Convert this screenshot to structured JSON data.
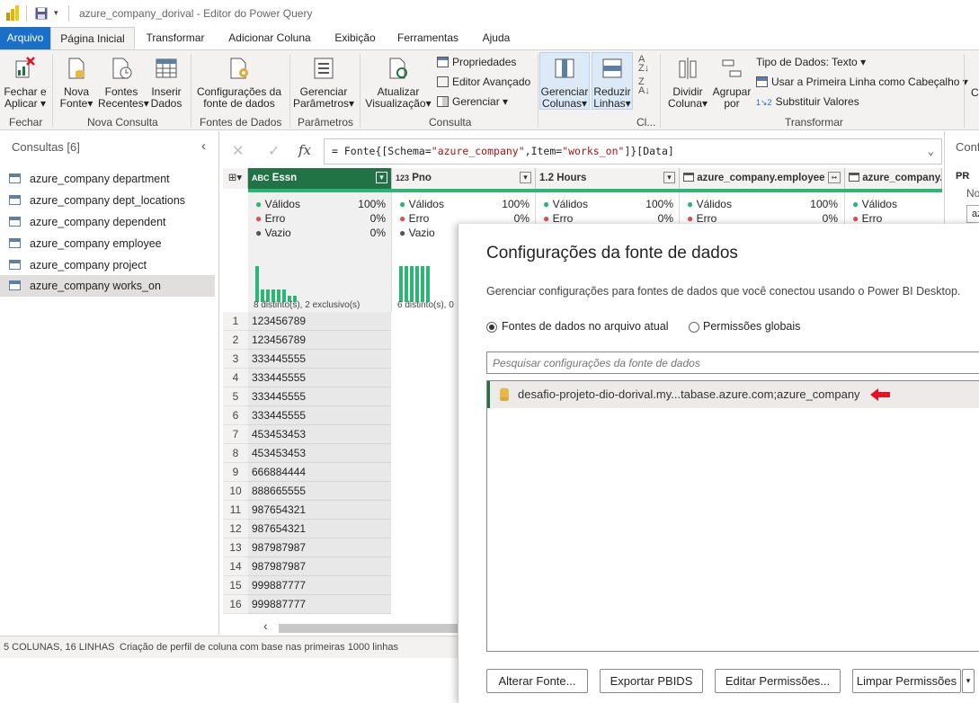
{
  "window": {
    "title": "azure_company_dorival - Editor do Power Query"
  },
  "tabs": [
    {
      "label": "Arquivo"
    },
    {
      "label": "Página Inicial"
    },
    {
      "label": "Transformar"
    },
    {
      "label": "Adicionar Coluna"
    },
    {
      "label": "Exibição"
    },
    {
      "label": "Ferramentas"
    },
    {
      "label": "Ajuda"
    }
  ],
  "ribbon": {
    "fechar_aplicar_1": "Fechar e",
    "fechar_aplicar_2": "Aplicar",
    "nova_fonte_1": "Nova",
    "nova_fonte_2": "Fonte",
    "fontes_recentes_1": "Fontes",
    "fontes_recentes_2": "Recentes",
    "inserir_dados_1": "Inserir",
    "inserir_dados_2": "Dados",
    "config_fonte_1": "Configurações da",
    "config_fonte_2": "fonte de dados",
    "gerenciar_param_1": "Gerenciar",
    "gerenciar_param_2": "Parâmetros",
    "atualizar_1": "Atualizar",
    "atualizar_2": "Visualização",
    "propriedades": "Propriedades",
    "editor_avancado": "Editor Avançado",
    "gerenciar": "Gerenciar",
    "gerenciar_colunas_1": "Gerenciar",
    "gerenciar_colunas_2": "Colunas",
    "reduzir_linhas_1": "Reduzir",
    "reduzir_linhas_2": "Linhas",
    "dividir_coluna_1": "Dividir",
    "dividir_coluna_2": "Coluna",
    "agrupar_por_1": "Agrupar",
    "agrupar_por_2": "por",
    "tipo_dados": "Tipo de Dados: Texto",
    "primeira_linha": "Usar a Primeira Linha como Cabeçalho",
    "substituir": "Substituir Valores",
    "cut_label": "Co",
    "groups": {
      "fechar": "Fechar",
      "nova_consulta": "Nova Consulta",
      "fontes_dados": "Fontes de Dados",
      "parametros": "Parâmetros",
      "consulta": "Consulta",
      "cl": "Cl...",
      "transformar": "Transformar"
    }
  },
  "sidebar": {
    "title": "Consultas [6]",
    "items": [
      {
        "label": "azure_company department"
      },
      {
        "label": "azure_company dept_locations"
      },
      {
        "label": "azure_company dependent"
      },
      {
        "label": "azure_company employee"
      },
      {
        "label": "azure_company project"
      },
      {
        "label": "azure_company works_on"
      }
    ]
  },
  "formula": {
    "prefix": "= Fonte{[Schema=",
    "schema": "\"azure_company\"",
    "mid": ",Item=",
    "item": "\"works_on\"",
    "suffix": "]}[Data]"
  },
  "columns": [
    {
      "type": "ABC",
      "name": "Essn",
      "valid": "100%",
      "error": "0%",
      "empty": "0%",
      "distinct": "8 distinto(s), 2 exclusivo(s)"
    },
    {
      "type": "123",
      "name": "Pno",
      "valid": "100%",
      "error": "0%",
      "empty": "0%",
      "distinct": "6 distinto(s), 0"
    },
    {
      "type": "1.2",
      "name": "Hours",
      "valid": "100%",
      "error": "0%"
    },
    {
      "type": "table",
      "name": "azure_company.employee",
      "valid": "100%",
      "error": "0%"
    },
    {
      "type": "table",
      "name": "azure_company."
    }
  ],
  "profile_labels": {
    "valid": "Válidos",
    "error": "Erro",
    "empty": "Vazio"
  },
  "rows": [
    {
      "n": "1",
      "essn": "123456789"
    },
    {
      "n": "2",
      "essn": "123456789"
    },
    {
      "n": "3",
      "essn": "333445555"
    },
    {
      "n": "4",
      "essn": "333445555"
    },
    {
      "n": "5",
      "essn": "333445555"
    },
    {
      "n": "6",
      "essn": "333445555"
    },
    {
      "n": "7",
      "essn": "453453453"
    },
    {
      "n": "8",
      "essn": "453453453"
    },
    {
      "n": "9",
      "essn": "666884444"
    },
    {
      "n": "10",
      "essn": "888665555"
    },
    {
      "n": "11",
      "essn": "987654321"
    },
    {
      "n": "12",
      "essn": "987654321"
    },
    {
      "n": "13",
      "essn": "987987987"
    },
    {
      "n": "14",
      "essn": "987987987"
    },
    {
      "n": "15",
      "essn": "999887777"
    },
    {
      "n": "16",
      "essn": "999887777"
    }
  ],
  "right_panel": {
    "title": "Conf",
    "section": "PR",
    "label": "No",
    "input": "az"
  },
  "status": {
    "left": "5 COLUNAS, 16 LINHAS",
    "right": "Criação de perfil de coluna com base nas primeiras 1000 linhas"
  },
  "dialog": {
    "title": "Configurações da fonte de dados",
    "description": "Gerenciar configurações para fontes de dados que você conectou usando o Power BI Desktop.",
    "radio_current": "Fontes de dados no arquivo atual",
    "radio_global": "Permissões globais",
    "search_placeholder": "Pesquisar configurações da fonte de dados",
    "source": "desafio-projeto-dio-dorival.my...tabase.azure.com;azure_company",
    "buttons": {
      "change": "Alterar Fonte...",
      "export": "Exportar PBIDS",
      "edit": "Editar Permissões...",
      "clear": "Limpar Permissões"
    }
  },
  "colors": {
    "accent": "#217346",
    "file_tab": "#1a6fc9",
    "arrow": "#e81123",
    "db_icon": "#e8b84a"
  }
}
